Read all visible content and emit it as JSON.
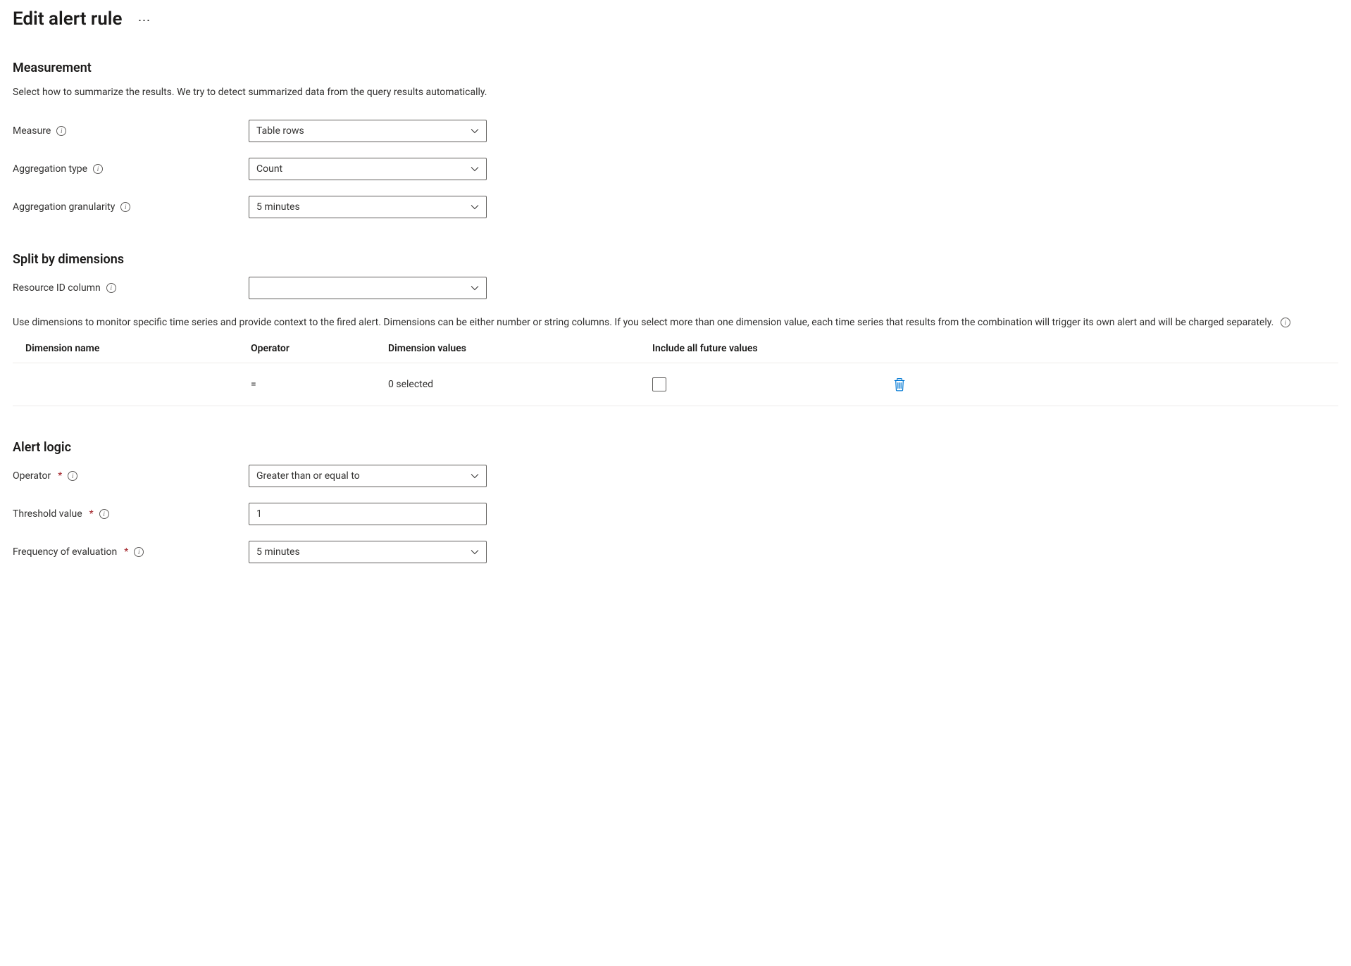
{
  "page": {
    "title": "Edit alert rule"
  },
  "measurement": {
    "heading": "Measurement",
    "description": "Select how to summarize the results. We try to detect summarized data from the query results automatically.",
    "measure_label": "Measure",
    "measure_value": "Table rows",
    "agg_type_label": "Aggregation type",
    "agg_type_value": "Count",
    "agg_gran_label": "Aggregation granularity",
    "agg_gran_value": "5 minutes"
  },
  "dimensions": {
    "heading": "Split by dimensions",
    "resource_label": "Resource ID column",
    "resource_value": "",
    "description": "Use dimensions to monitor specific time series and provide context to the fired alert. Dimensions can be either number or string columns. If you select more than one dimension value, each time series that results from the combination will trigger its own alert and will be charged separately.",
    "columns": {
      "name": "Dimension name",
      "operator": "Operator",
      "values": "Dimension values",
      "include_all": "Include all future values"
    },
    "row": {
      "name": "",
      "operator": "=",
      "values": "0 selected",
      "include_all": false
    }
  },
  "alert_logic": {
    "heading": "Alert logic",
    "operator_label": "Operator",
    "operator_value": "Greater than or equal to",
    "threshold_label": "Threshold value",
    "threshold_value": "1",
    "frequency_label": "Frequency of evaluation",
    "frequency_value": "5 minutes"
  }
}
